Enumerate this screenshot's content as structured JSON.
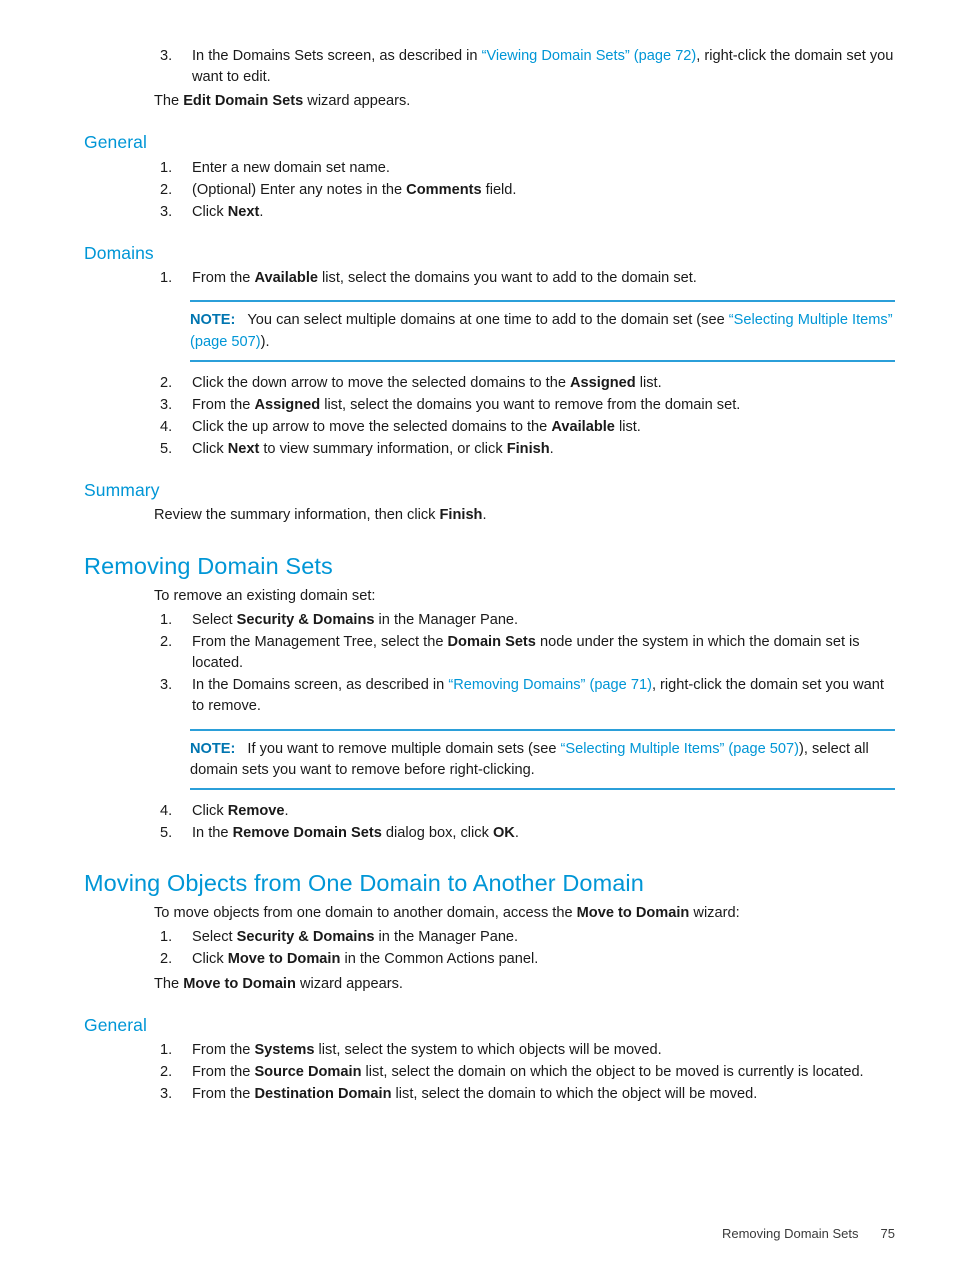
{
  "page": {
    "footer_title": "Removing Domain Sets",
    "footer_number": "75"
  },
  "colors": {
    "heading_blue": "#0096d6",
    "link_blue": "#0096d6",
    "note_label_blue": "#0075b0",
    "note_rule_blue": "#2b9fd9",
    "body_text": "#1a1a1a"
  },
  "intro": {
    "item3": {
      "num": "3.",
      "text_a": "In the Domains Sets screen, as described in ",
      "link": "“Viewing Domain Sets” (page 72)",
      "text_b": ", right-click the domain set you want to edit."
    },
    "wizard_para": {
      "text_a": "The ",
      "bold": "Edit Domain Sets",
      "text_b": " wizard appears."
    }
  },
  "general_1": {
    "heading": "General",
    "items": [
      {
        "num": "1.",
        "text_a": "Enter a new domain set name.",
        "bold": "",
        "text_b": ""
      },
      {
        "num": "2.",
        "text_a": "(Optional) Enter any notes in the ",
        "bold": "Comments",
        "text_b": " field."
      },
      {
        "num": "3.",
        "text_a": "Click ",
        "bold": "Next",
        "text_b": "."
      }
    ]
  },
  "domains": {
    "heading": "Domains",
    "item1": {
      "num": "1.",
      "text_a": "From the ",
      "bold": "Available",
      "text_b": " list, select the domains you want to add to the domain set."
    },
    "note": {
      "label": "NOTE:",
      "text_a": "You can select multiple domains at one time to add to the domain set (see ",
      "link": "“Selecting Multiple Items” (page 507)",
      "text_b": ")."
    },
    "items": [
      {
        "num": "2.",
        "text_a": "Click the down arrow to move the selected domains to the ",
        "bold": "Assigned",
        "text_b": " list."
      },
      {
        "num": "3.",
        "text_a": "From the ",
        "bold": "Assigned",
        "text_b": " list, select the domains you want to remove from the domain set."
      },
      {
        "num": "4.",
        "text_a": "Click the up arrow to move the selected domains to the ",
        "bold": "Available",
        "text_b": " list."
      }
    ],
    "item5": {
      "num": "5.",
      "text_a": "Click ",
      "bold1": "Next",
      "text_b": " to view summary information, or click ",
      "bold2": "Finish",
      "text_c": "."
    }
  },
  "summary": {
    "heading": "Summary",
    "para": {
      "text_a": "Review the summary information, then click ",
      "bold": "Finish",
      "text_b": "."
    }
  },
  "removing_domain_sets": {
    "heading": "Removing Domain Sets",
    "intro": "To remove an existing domain set:",
    "items": [
      {
        "num": "1.",
        "text_a": "Select ",
        "bold": "Security & Domains",
        "text_b": " in the Manager Pane."
      },
      {
        "num": "2.",
        "text_a": "From the Management Tree, select the ",
        "bold": "Domain Sets",
        "text_b": " node under the system in which the domain set is located."
      }
    ],
    "item3": {
      "num": "3.",
      "text_a": "In the Domains screen, as described in ",
      "link": "“Removing Domains” (page 71)",
      "text_b": ", right-click the domain set you want to remove."
    },
    "note": {
      "label": "NOTE:",
      "text_a": "If you want to remove multiple domain sets (see ",
      "link": "“Selecting Multiple Items” (page 507)",
      "text_b": "), select all domain sets you want to remove before right-clicking."
    },
    "items_after": [
      {
        "num": "4.",
        "text_a": "Click ",
        "bold": "Remove",
        "text_b": "."
      },
      {
        "num": "5.",
        "text_a": "In the ",
        "bold": "Remove Domain Sets",
        "text_b": " dialog box, click ",
        "bold2": "OK",
        "text_c": "."
      }
    ]
  },
  "moving_objects": {
    "heading": "Moving Objects from One Domain to Another Domain",
    "intro": {
      "text_a": "To move objects from one domain to another domain, access the ",
      "bold": "Move to Domain",
      "text_b": " wizard:"
    },
    "items": [
      {
        "num": "1.",
        "text_a": "Select ",
        "bold": "Security & Domains",
        "text_b": " in the Manager Pane."
      },
      {
        "num": "2.",
        "text_a": "Click ",
        "bold": "Move to Domain",
        "text_b": " in the Common Actions panel."
      }
    ],
    "wizard_para": {
      "text_a": "The ",
      "bold": "Move to Domain",
      "text_b": " wizard appears."
    }
  },
  "general_2": {
    "heading": "General",
    "items": [
      {
        "num": "1.",
        "text_a": "From the ",
        "bold": "Systems",
        "text_b": " list, select the system to which objects will be moved."
      },
      {
        "num": "2.",
        "text_a": "From the ",
        "bold": "Source Domain",
        "text_b": " list, select the domain on which the object to be moved is currently is located."
      },
      {
        "num": "3.",
        "text_a": "From the ",
        "bold": "Destination Domain",
        "text_b": " list, select the domain to which the object will be moved."
      }
    ]
  }
}
